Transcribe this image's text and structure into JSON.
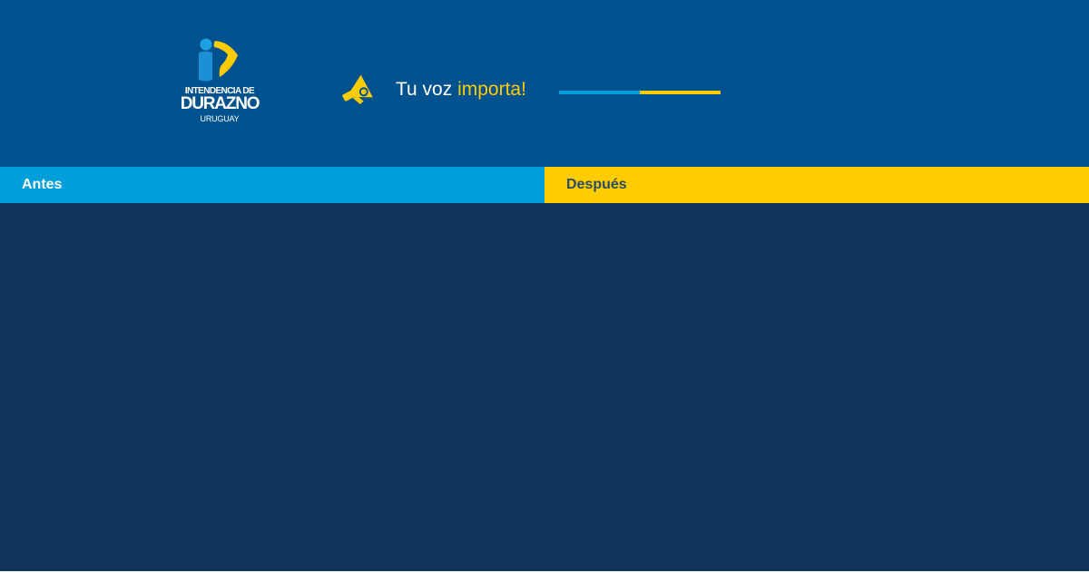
{
  "header": {
    "logo": {
      "line1": "INTENDENCIA DE",
      "line2": "DURAZNO",
      "line3": "URUGUAY",
      "icon": "intendencia-logo-icon"
    },
    "megaphone_icon": "megaphone-icon",
    "slogan": {
      "prefix": "Tu voz ",
      "highlight": "importa!"
    }
  },
  "tabs": {
    "before": "Antes",
    "after": "Después"
  },
  "colors": {
    "header_bg": "#00528e",
    "content_bg": "#11345a",
    "accent_blue": "#009edb",
    "accent_yellow": "#ffcc00"
  }
}
